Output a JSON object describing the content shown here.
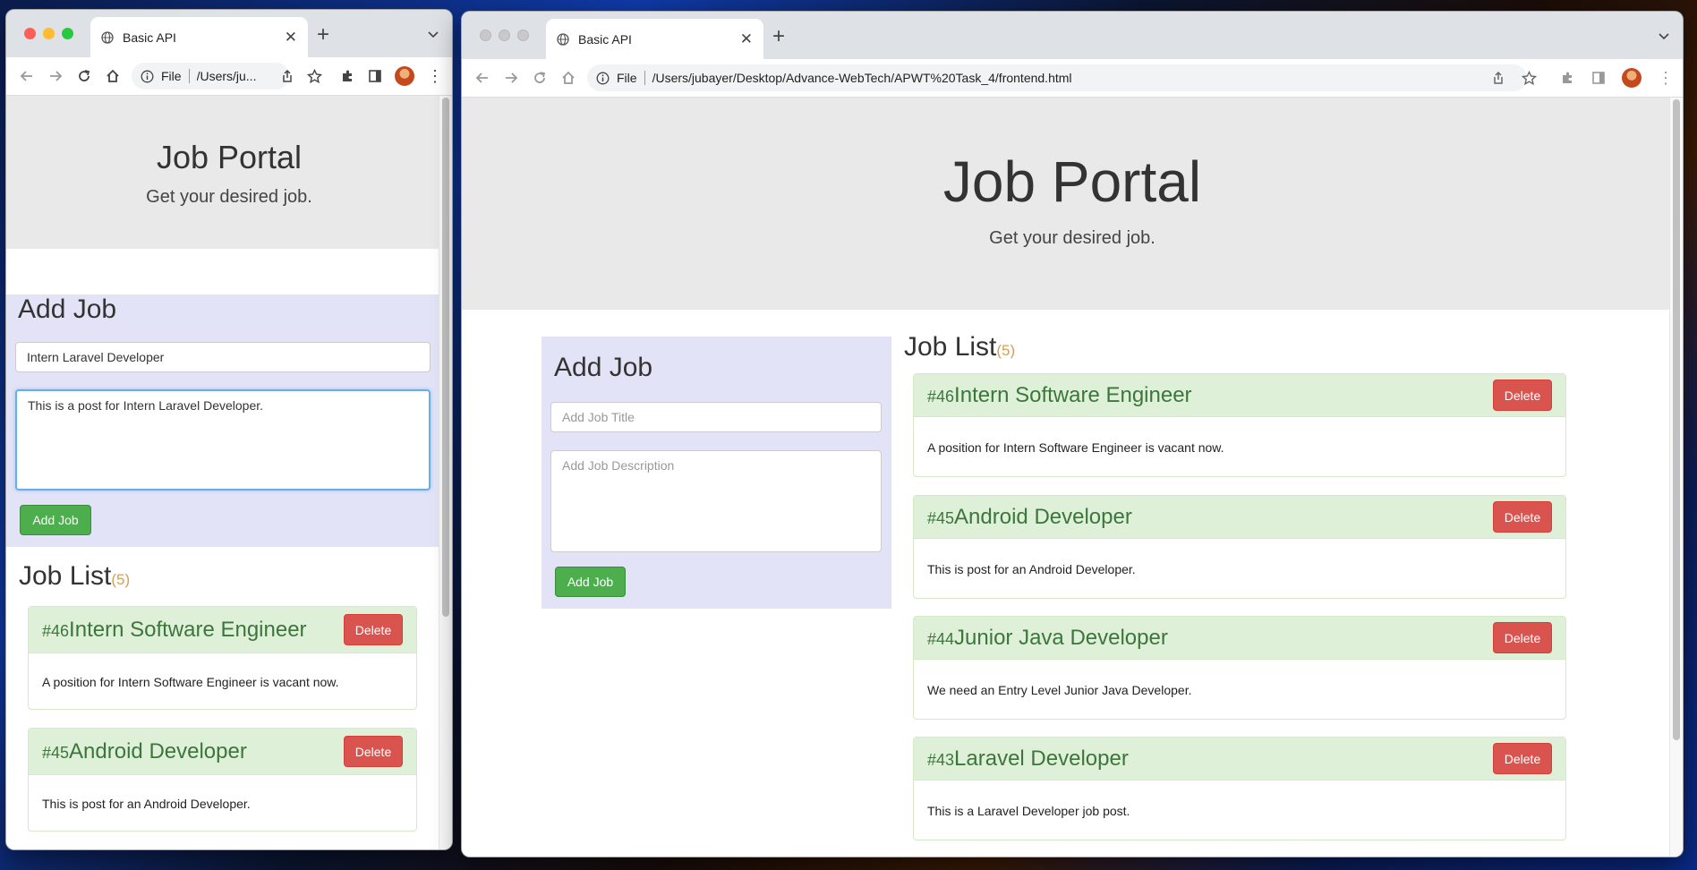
{
  "colors": {
    "hero_bg": "#e9e9e9",
    "panel_bg": "#e3e3f7",
    "job_header_bg": "#dff0d8",
    "job_title": "#3c763d",
    "delete_btn": "#d9534f",
    "add_btn": "#4cae4c",
    "count": "#d4a05a"
  },
  "icons": [
    "globe-icon",
    "close-icon",
    "plus-icon",
    "chevron-down-icon",
    "back-icon",
    "forward-icon",
    "reload-icon",
    "home-icon",
    "info-icon",
    "share-icon",
    "star-icon",
    "extensions-icon",
    "sidebar-icon",
    "avatar",
    "more-icon"
  ],
  "left_window": {
    "tab_title": "Basic API",
    "url_scheme": "File",
    "url_path": "/Users/ju...",
    "page": {
      "title": "Job Portal",
      "subtitle": "Get your desired job.",
      "add_job": {
        "heading": "Add Job",
        "title_value": "Intern Laravel Developer",
        "description_value": "This is a post for Intern Laravel Developer.",
        "button_label": "Add Job"
      },
      "job_list": {
        "heading": "Job List",
        "count": "(5)",
        "jobs": [
          {
            "id": "#46",
            "title": "Intern Software Engineer",
            "description": "A position for Intern Software Engineer is vacant now.",
            "delete_label": "Delete"
          },
          {
            "id": "#45",
            "title": "Android Developer",
            "description": "This is post for an Android Developer.",
            "delete_label": "Delete"
          }
        ]
      }
    }
  },
  "right_window": {
    "tab_title": "Basic API",
    "url_scheme": "File",
    "url_path": "/Users/jubayer/Desktop/Advance-WebTech/APWT%20Task_4/frontend.html",
    "page": {
      "title": "Job Portal",
      "subtitle": "Get your desired job.",
      "add_job": {
        "heading": "Add Job",
        "title_placeholder": "Add Job Title",
        "description_placeholder": "Add Job Description",
        "button_label": "Add Job"
      },
      "job_list": {
        "heading": "Job List",
        "count": "(5)",
        "jobs": [
          {
            "id": "#46",
            "title": "Intern Software Engineer",
            "description": "A position for Intern Software Engineer is vacant now.",
            "delete_label": "Delete"
          },
          {
            "id": "#45",
            "title": "Android Developer",
            "description": "This is post for an Android Developer.",
            "delete_label": "Delete"
          },
          {
            "id": "#44",
            "title": "Junior Java Developer",
            "description": "We need an Entry Level Junior Java Developer.",
            "delete_label": "Delete"
          },
          {
            "id": "#43",
            "title": "Laravel Developer",
            "description": "This is a Laravel Developer job post.",
            "delete_label": "Delete"
          }
        ]
      }
    }
  }
}
